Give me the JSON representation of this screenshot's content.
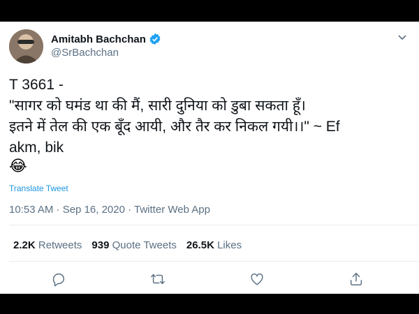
{
  "tweet": {
    "author_name": "Amitabh Bachchan",
    "handle": "@SrBachchan",
    "lines": [
      "T 3661 -",
      "\"सागर को घमंड था की मैं, सारी दुनिया को डुबा सकता हूँ।",
      "इतने में तेल की एक बूँद आयी, और तैर कर निकल गयी।।\" ~ Ef",
      "akm, bik"
    ],
    "emoji": "😂",
    "translate_label": "Translate Tweet",
    "timestamp": "10:53 AM · Sep 16, 2020 · Twitter Web App"
  },
  "stats": {
    "retweets_count": "2.2K",
    "retweets_label": "Retweets",
    "quotes_count": "939",
    "quotes_label": "Quote Tweets",
    "likes_count": "26.5K",
    "likes_label": "Likes"
  },
  "colors": {
    "accent": "#1da1f2",
    "text": "#0f1419",
    "muted": "#5b7083"
  },
  "icons": [
    "verified-badge-icon",
    "chevron-down-icon",
    "reply-icon",
    "retweet-icon",
    "like-icon",
    "share-icon"
  ]
}
